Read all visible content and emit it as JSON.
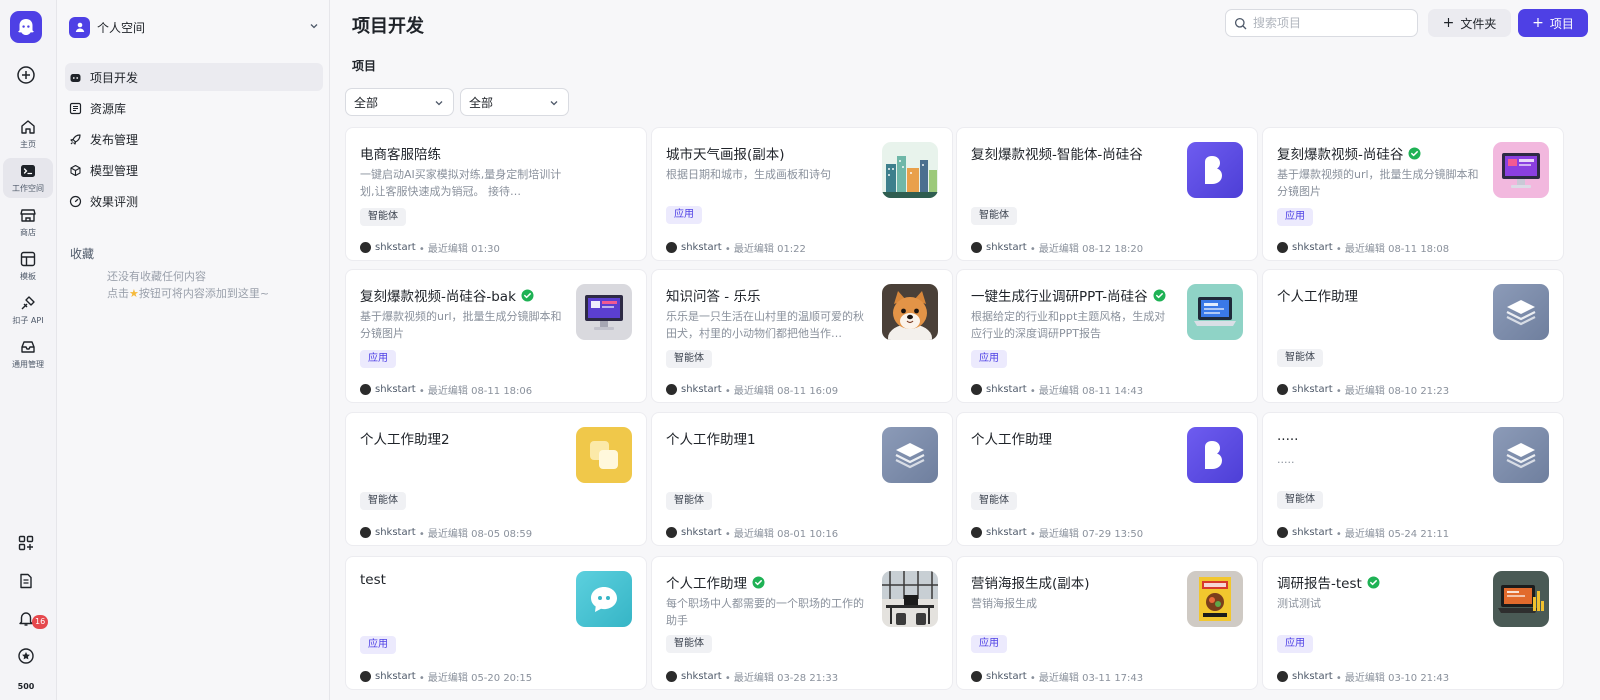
{
  "rail": {
    "items": [
      {
        "label": "主页",
        "icon": "home-icon"
      },
      {
        "label": "工作空间",
        "icon": "terminal-icon",
        "active": true
      },
      {
        "label": "商店",
        "icon": "store-icon"
      },
      {
        "label": "模板",
        "icon": "template-icon"
      },
      {
        "label": "扣子 API",
        "icon": "api-icon"
      },
      {
        "label": "通用管理",
        "icon": "inbox-icon"
      }
    ],
    "notification_count": "16",
    "points": "500"
  },
  "sidebar": {
    "space_name": "个人空间",
    "nav": [
      {
        "label": "项目开发",
        "icon": "bot-icon",
        "active": true
      },
      {
        "label": "资源库",
        "icon": "library-icon"
      },
      {
        "label": "发布管理",
        "icon": "rocket-icon"
      },
      {
        "label": "模型管理",
        "icon": "cube-icon"
      },
      {
        "label": "效果评测",
        "icon": "gauge-icon"
      }
    ],
    "favorites_title": "收藏",
    "favorites_empty_line1": "还没有收藏任何内容",
    "favorites_empty_line2_pre": "点击",
    "favorites_empty_line2_post": "按钮可将内容添加到这里~"
  },
  "header": {
    "title": "项目开发",
    "search_placeholder": "搜索项目",
    "folder_button": "文件夹",
    "project_button": "项目"
  },
  "main": {
    "section_label": "项目",
    "filter1": "全部",
    "filter2": "全部"
  },
  "colors": {
    "accent": "#4e40e5",
    "verified": "#1fb255",
    "badge": "#e5484d"
  },
  "cards": [
    {
      "title": "电商客服陪练",
      "desc": "一键启动AI买家模拟对练,量身定制培训计划,让客服快速成为销冠。 接待…",
      "tag": "智能体",
      "author": "shkstart",
      "edited": "• 最近编辑 01:30",
      "verified": false,
      "thumb": "none"
    },
    {
      "title": "城市天气画报(副本)",
      "desc": "根据日期和城市，生成画板和诗句",
      "tag": "应用",
      "author": "shkstart",
      "edited": "• 最近编辑 01:22",
      "verified": false,
      "thumb": "city-illustration"
    },
    {
      "title": "复刻爆款视频-智能体-尚硅谷",
      "desc": "",
      "tag": "智能体",
      "author": "shkstart",
      "edited": "• 最近编辑 08-12 18:20",
      "verified": false,
      "thumb": "purple-b-logo"
    },
    {
      "title": "复刻爆款视频-尚硅谷",
      "desc": "基于爆款视频的url，批量生成分镜脚本和分镜图片",
      "tag": "应用",
      "author": "shkstart",
      "edited": "• 最近编辑 08-11 18:08",
      "verified": true,
      "thumb": "pink-monitor"
    },
    {
      "title": "复刻爆款视频-尚硅谷-bak",
      "desc": "基于爆款视频的url，批量生成分镜脚本和分镜图片",
      "tag": "应用",
      "author": "shkstart",
      "edited": "• 最近编辑 08-11 18:06",
      "verified": true,
      "thumb": "gray-monitor"
    },
    {
      "title": "知识问答 - 乐乐",
      "desc": "乐乐是一只生活在山村里的温顺可爱的秋田犬，村里的小动物们都把他当作…",
      "tag": "智能体",
      "author": "shkstart",
      "edited": "• 最近编辑 08-11 16:09",
      "verified": false,
      "thumb": "dog-photo"
    },
    {
      "title": "一键生成行业调研PPT-尚硅谷",
      "desc": "根据给定的行业和ppt主题风格，生成对应行业的深度调研PPT报告",
      "tag": "应用",
      "author": "shkstart",
      "edited": "• 最近编辑 08-11 14:43",
      "verified": true,
      "thumb": "teal-laptop"
    },
    {
      "title": "个人工作助理",
      "desc": "",
      "tag": "智能体",
      "author": "shkstart",
      "edited": "• 最近编辑 08-10 21:23",
      "verified": false,
      "thumb": "layers-logo"
    },
    {
      "title": "个人工作助理2",
      "desc": "",
      "tag": "智能体",
      "author": "shkstart",
      "edited": "• 最近编辑 08-05 08:59",
      "verified": false,
      "thumb": "yellow-squares"
    },
    {
      "title": "个人工作助理1",
      "desc": "",
      "tag": "智能体",
      "author": "shkstart",
      "edited": "• 最近编辑 08-01 10:16",
      "verified": false,
      "thumb": "layers-logo"
    },
    {
      "title": "个人工作助理",
      "desc": "",
      "tag": "智能体",
      "author": "shkstart",
      "edited": "• 最近编辑 07-29 13:50",
      "verified": false,
      "thumb": "purple-b-logo"
    },
    {
      "title": ".....",
      "desc": ".....",
      "tag": "智能体",
      "author": "shkstart",
      "edited": "• 最近编辑 05-24 21:11",
      "verified": false,
      "thumb": "layers-logo"
    },
    {
      "title": "test",
      "desc": "",
      "tag": "应用",
      "author": "shkstart",
      "edited": "• 最近编辑 05-20 20:15",
      "verified": false,
      "thumb": "chat-bubble"
    },
    {
      "title": "个人工作助理",
      "desc": "每个职场中人都需要的一个职场的工作的助手",
      "tag": "智能体",
      "author": "shkstart",
      "edited": "• 最近编辑 03-28 21:33",
      "verified": true,
      "thumb": "office-photo"
    },
    {
      "title": "营销海报生成(副本)",
      "desc": "营销海报生成",
      "tag": "应用",
      "author": "shkstart",
      "edited": "• 最近编辑 03-11 17:43",
      "verified": false,
      "thumb": "poster-photo"
    },
    {
      "title": "调研报告-test",
      "desc": "测试测试",
      "tag": "应用",
      "author": "shkstart",
      "edited": "• 最近编辑 03-10 21:43",
      "verified": true,
      "thumb": "report-laptop"
    }
  ]
}
